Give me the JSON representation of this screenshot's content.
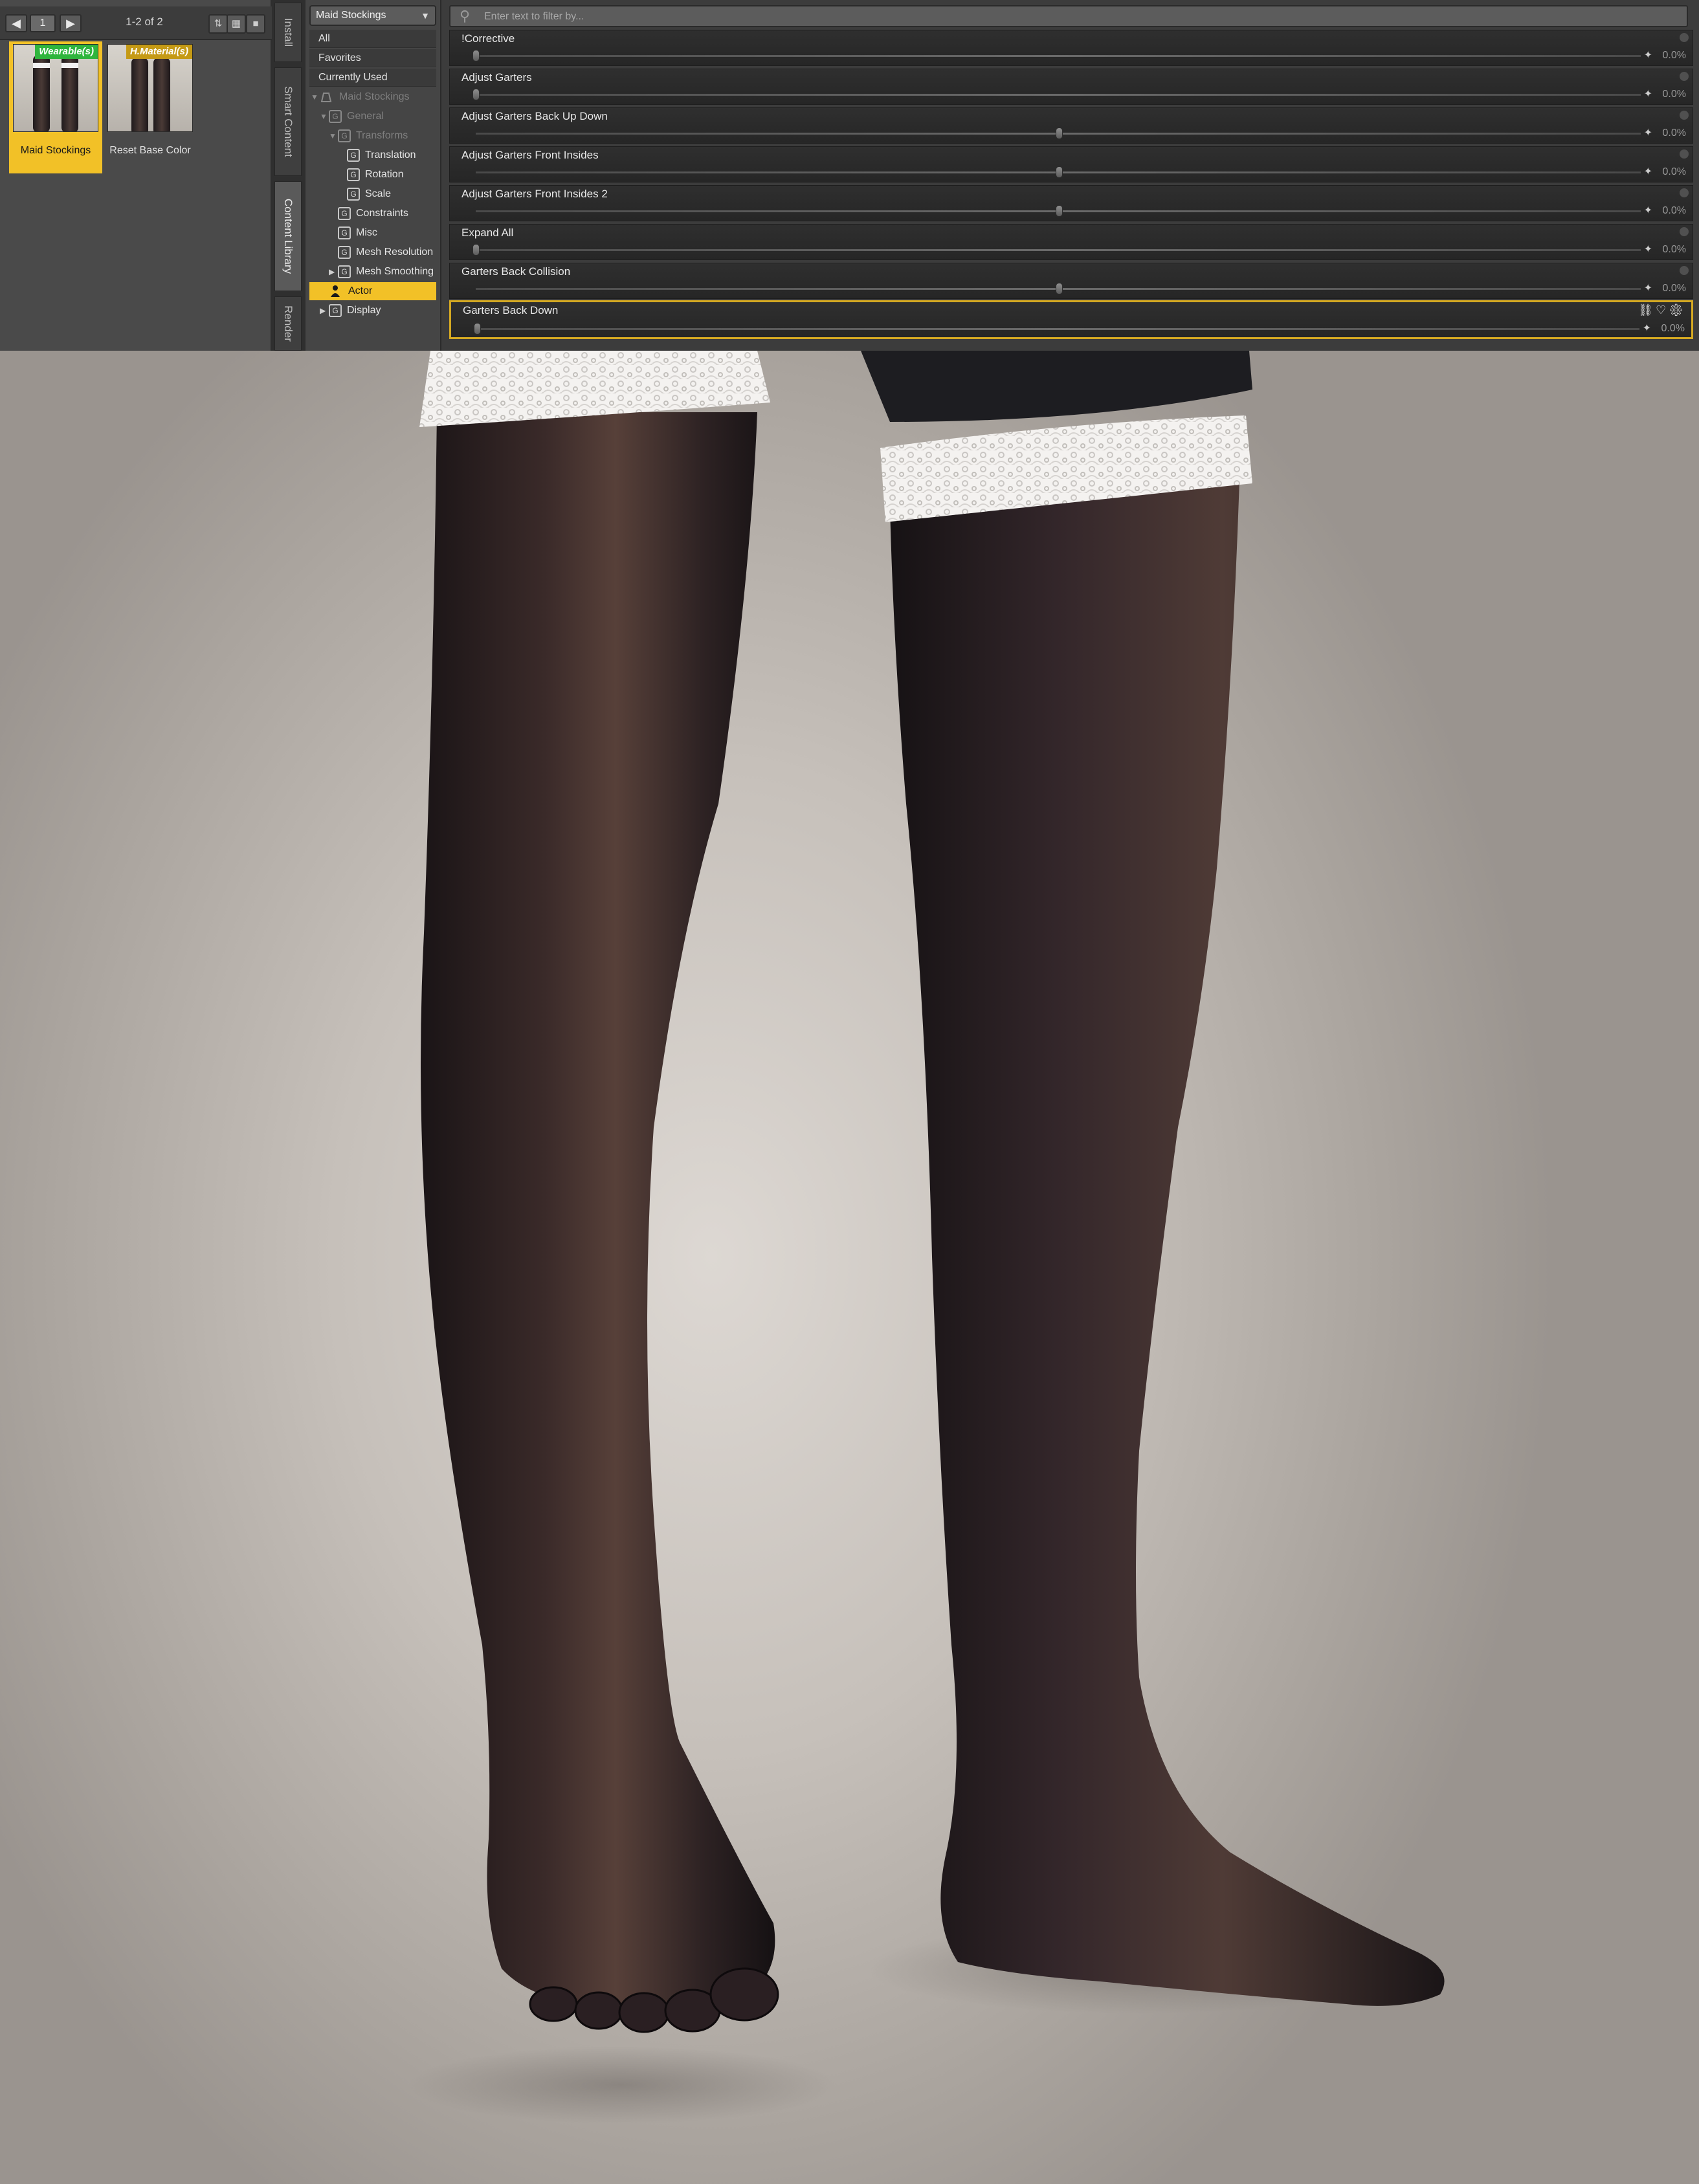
{
  "browser": {
    "prev_icon": "arrow-left-icon",
    "next_icon": "arrow-right-icon",
    "page": "1",
    "page_count": "1-2 of 2",
    "sort_icon": "sort-arrows-icon",
    "grid_icon": "grid-view-icon",
    "list_icon": "list-view-icon",
    "items": [
      {
        "label": "Maid Stockings",
        "badge": "Wearable(s)",
        "selected": true
      },
      {
        "label": "Reset Base Color",
        "badge": "H.Material(s)",
        "selected": false
      }
    ]
  },
  "side_tabs": [
    "Install",
    "Smart Content",
    "Content Library",
    "Render"
  ],
  "tree": {
    "selector": "Maid Stockings",
    "base_items": [
      "All",
      "Favorites",
      "Currently Used"
    ],
    "nodes": {
      "root": "Maid Stockings",
      "general": "General",
      "transforms": "Transforms",
      "translation": "Translation",
      "rotation": "Rotation",
      "scale": "Scale",
      "constraints": "Constraints",
      "misc": "Misc",
      "mesh_resolution": "Mesh Resolution",
      "mesh_smoothing": "Mesh Smoothing",
      "actor": "Actor",
      "display": "Display"
    }
  },
  "params": {
    "filter_placeholder": "Enter text to filter by...",
    "rows": [
      {
        "name": "!Corrective",
        "value": "0.0%",
        "level": 0.0,
        "slider": "unipolar"
      },
      {
        "name": "Adjust Garters",
        "value": "0.0%",
        "level": 0.0,
        "slider": "unipolar"
      },
      {
        "name": "Adjust Garters Back Up Down",
        "value": "0.0%",
        "level": 0.0,
        "slider": "bipolar"
      },
      {
        "name": "Adjust Garters Front Insides",
        "value": "0.0%",
        "level": 0.0,
        "slider": "bipolar"
      },
      {
        "name": "Adjust Garters Front Insides 2",
        "value": "0.0%",
        "level": 0.0,
        "slider": "bipolar"
      },
      {
        "name": "Expand All",
        "value": "0.0%",
        "level": 0.0,
        "slider": "unipolar"
      },
      {
        "name": "Garters Back Collision",
        "value": "0.0%",
        "level": 0.0,
        "slider": "bipolar"
      },
      {
        "name": "Garters Back Down",
        "value": "0.0%",
        "level": 0.0,
        "slider": "unipolar",
        "selected": true
      }
    ]
  },
  "colors": {
    "accent": "#f2c127",
    "panel": "#3c3c3c",
    "badge_wearable": "#2fb53d",
    "badge_material": "#c59a15"
  }
}
